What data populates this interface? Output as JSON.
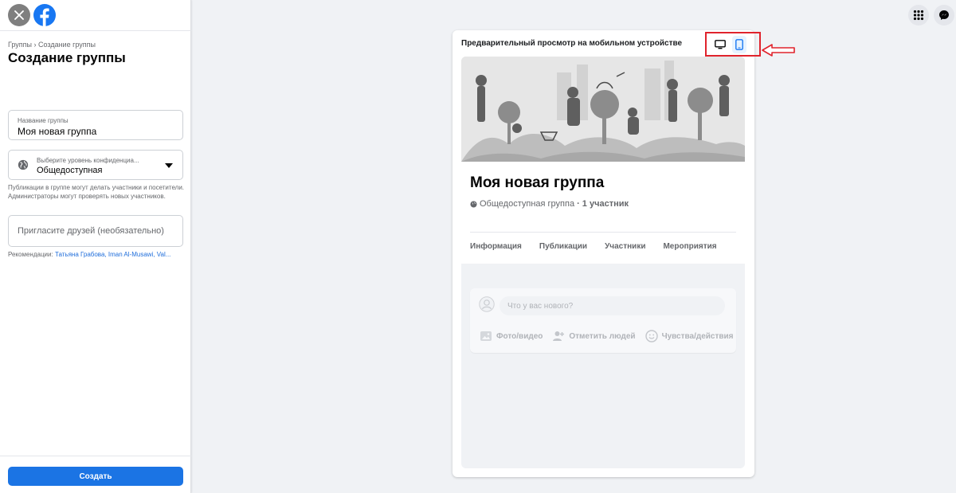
{
  "sidebar": {
    "breadcrumb": "Группы › Создание группы",
    "title": "Создание группы",
    "group_name_label": "Название группы",
    "group_name_value": "Моя новая группа",
    "privacy_label": "Выберите уровень конфиденциа...",
    "privacy_value": "Общедоступная",
    "privacy_help": "Публикации в группе могут делать участники и посетители. Администраторы могут проверять новых участников.",
    "invite_placeholder": "Пригласите друзей (необязательно)",
    "recommend_label": "Рекомендации:",
    "recommend_names": "Татьяна Грабова, Iman Al-Musawi, Val...",
    "create_button": "Создать"
  },
  "preview": {
    "title": "Предварительный просмотр на мобильном устройстве",
    "group_name": "Моя новая группа",
    "group_type": "Общедоступная группа",
    "members": "· 1 участник",
    "tabs": [
      {
        "label": "Информация"
      },
      {
        "label": "Публикации"
      },
      {
        "label": "Участники"
      },
      {
        "label": "Мероприятия"
      }
    ],
    "composer_placeholder": "Что у вас нового?",
    "actions": {
      "photo": "Фото/видео",
      "tag": "Отметить людей",
      "feeling": "Чувства/действия"
    }
  },
  "colors": {
    "brand": "#1877f2",
    "button": "#1b74e4",
    "annotation": "#e0232c"
  },
  "icons": [
    "close-icon",
    "facebook-logo-icon",
    "globe-icon",
    "apps-grid-icon",
    "messenger-icon",
    "desktop-icon",
    "mobile-icon",
    "arrow-icon",
    "avatar-icon",
    "photo-icon",
    "tag-people-icon",
    "smiley-icon"
  ]
}
